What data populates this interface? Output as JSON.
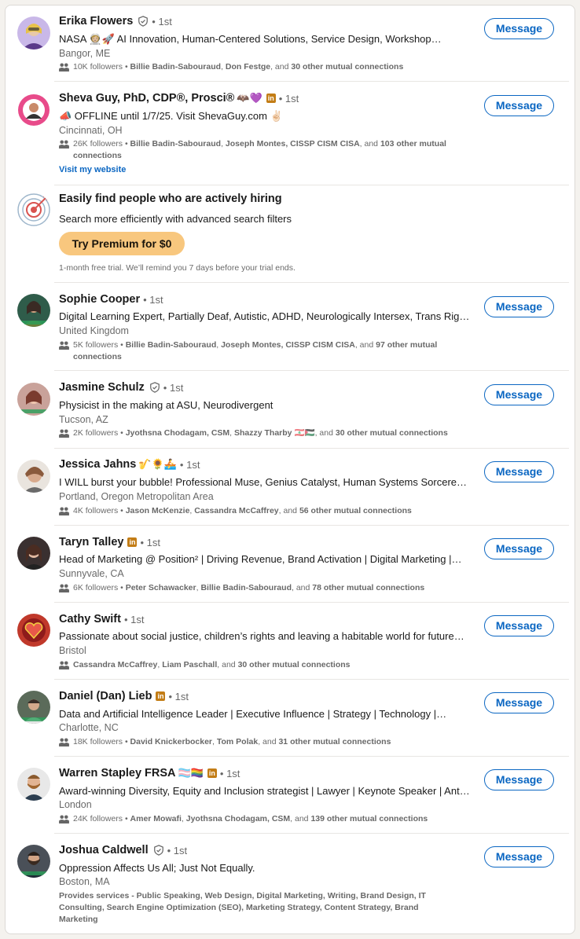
{
  "common": {
    "message_label": "Message",
    "dot_degree": "• 1st"
  },
  "people": [
    {
      "name": "Erika Flowers",
      "headline": "NASA 👩🏼‍🚀🚀 AI Innovation, Human-Centered Solutions, Service Design, Workshop…",
      "location": "Bangor, ME",
      "followers": "10K followers",
      "mutual_a": "Billie Badin-Sabouraud",
      "mutual_b": "Don Festge",
      "mutual_sep": ", ",
      "mutual_tail_pre": ", and ",
      "mutual_other": "30 other mutual connections"
    },
    {
      "name": "Sheva Guy, PhD, CDP®, Prosci®",
      "name_emoji": "🦇💜",
      "headline": "📣 OFFLINE until 1/7/25. Visit ShevaGuy.com ✌🏻",
      "location": "Cincinnati, OH",
      "followers": "26K followers",
      "mutual_a": "Billie Badin-Sabouraud",
      "mutual_b": "Joseph Montes, CISSP CISM CISA",
      "mutual_tail_pre": ", and ",
      "mutual_other": "103 other mutual connections",
      "link": "Visit my website"
    },
    {
      "name": "Sophie Cooper",
      "headline": "Digital Learning Expert, Partially Deaf, Autistic, ADHD, Neurologically Intersex, Trans Righ…",
      "location": "United Kingdom",
      "followers": "5K followers",
      "mutual_a": "Billie Badin-Sabouraud",
      "mutual_b": "Joseph Montes, CISSP CISM CISA",
      "mutual_tail_pre": ", and ",
      "mutual_other": "97 other mutual connections"
    },
    {
      "name": "Jasmine Schulz",
      "headline": "Physicist in the making at ASU, Neurodivergent",
      "location": "Tucson, AZ",
      "followers": "2K followers",
      "mutual_a": "Jyothsna Chodagam, CSM",
      "mutual_b": "Shazzy Tharby 🇱🇧🇵🇸",
      "mutual_tail_pre": ", and ",
      "mutual_other": "30 other mutual connections"
    },
    {
      "name": "Jessica Jahns",
      "name_emoji": "🎷🌻🚣",
      "headline": "I WILL burst your bubble! Professional Muse, Genius Catalyst, Human Systems Sorceress,…",
      "location": "Portland, Oregon Metropolitan Area",
      "followers": "4K followers",
      "mutual_a": "Jason McKenzie",
      "mutual_b": "Cassandra McCaffrey",
      "mutual_tail_pre": ", and ",
      "mutual_other": "56 other mutual connections"
    },
    {
      "name": "Taryn Talley",
      "headline": "Head of Marketing @ Position² | Driving Revenue, Brand Activation | Digital Marketing |…",
      "location": "Sunnyvale, CA",
      "followers": "6K followers",
      "mutual_a": "Peter Schawacker",
      "mutual_b": "Billie Badin-Sabouraud",
      "mutual_tail_pre": ", and ",
      "mutual_other": "78 other mutual connections"
    },
    {
      "name": "Cathy Swift",
      "headline": "Passionate about social justice, children’s rights and leaving a habitable world for future…",
      "location": "Bristol",
      "mutual_a": "Cassandra McCaffrey",
      "mutual_b": "Liam Paschall",
      "mutual_tail_pre": ", and ",
      "mutual_other": "30 other mutual connections"
    },
    {
      "name": "Daniel (Dan) Lieb",
      "headline": "Data and Artificial Intelligence Leader | Executive Influence | Strategy | Technology |…",
      "location": "Charlotte, NC",
      "followers": "18K followers",
      "mutual_a": "David Knickerbocker",
      "mutual_b": "Tom Polak",
      "mutual_tail_pre": ", and ",
      "mutual_other": "31 other mutual connections"
    },
    {
      "name": "Warren Stapley FRSA",
      "name_emoji": "🏳️‍⚧️🏳️‍🌈",
      "headline": "Award-winning Diversity, Equity and Inclusion strategist | Lawyer | Keynote Speaker | Anti-…",
      "location": "London",
      "followers": "24K followers",
      "mutual_a": "Amer Mowafi",
      "mutual_b": "Jyothsna Chodagam, CSM",
      "mutual_tail_pre": ", and ",
      "mutual_other": "139 other mutual connections"
    },
    {
      "name": "Joshua Caldwell",
      "headline": "Oppression Affects Us All; Just Not Equally.",
      "location": "Boston, MA",
      "services": "Provides services - Public Speaking, Web Design, Digital Marketing, Writing, Brand Design, IT Consulting, Search Engine Optimization (SEO), Marketing Strategy, Content Strategy, Brand Marketing"
    }
  ],
  "promo": {
    "title": "Easily find people who are actively hiring",
    "subtitle": "Search more efficiently with advanced search filters",
    "button": "Try Premium for $0",
    "note": "1-month free trial. We’ll remind you 7 days before your trial ends."
  },
  "colors": {
    "accent": "#0a66c2",
    "premium": "#f8c77e",
    "li_badge": "#c37d16"
  },
  "separator": " • "
}
